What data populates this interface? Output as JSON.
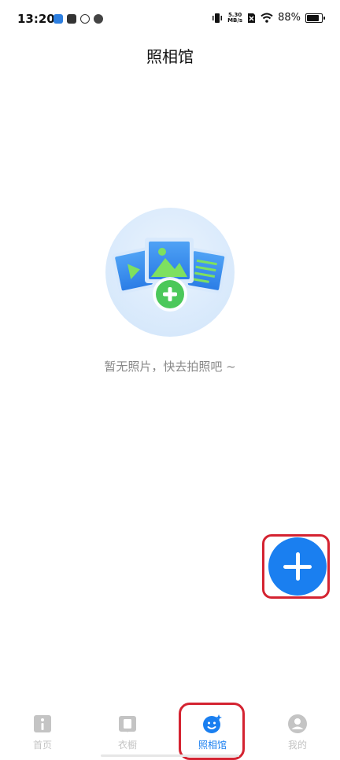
{
  "status_bar": {
    "time": "13:20",
    "net_speed_value": "5.30",
    "net_speed_unit": "MB/s",
    "battery_percent": "88%",
    "battery_level": 0.88
  },
  "header": {
    "title": "照相馆"
  },
  "empty_state": {
    "message": "暂无照片，快去拍照吧 ~"
  },
  "fab": {
    "icon": "plus-icon"
  },
  "tabs": [
    {
      "label": "首页",
      "icon": "home-icon",
      "active": false
    },
    {
      "label": "衣橱",
      "icon": "wardrobe-icon",
      "active": false
    },
    {
      "label": "照相馆",
      "icon": "photo-studio-icon",
      "active": true
    },
    {
      "label": "我的",
      "icon": "profile-icon",
      "active": false
    }
  ],
  "colors": {
    "accent": "#1a7ff0",
    "highlight": "#d42331",
    "inactive": "#c4c4c4"
  }
}
